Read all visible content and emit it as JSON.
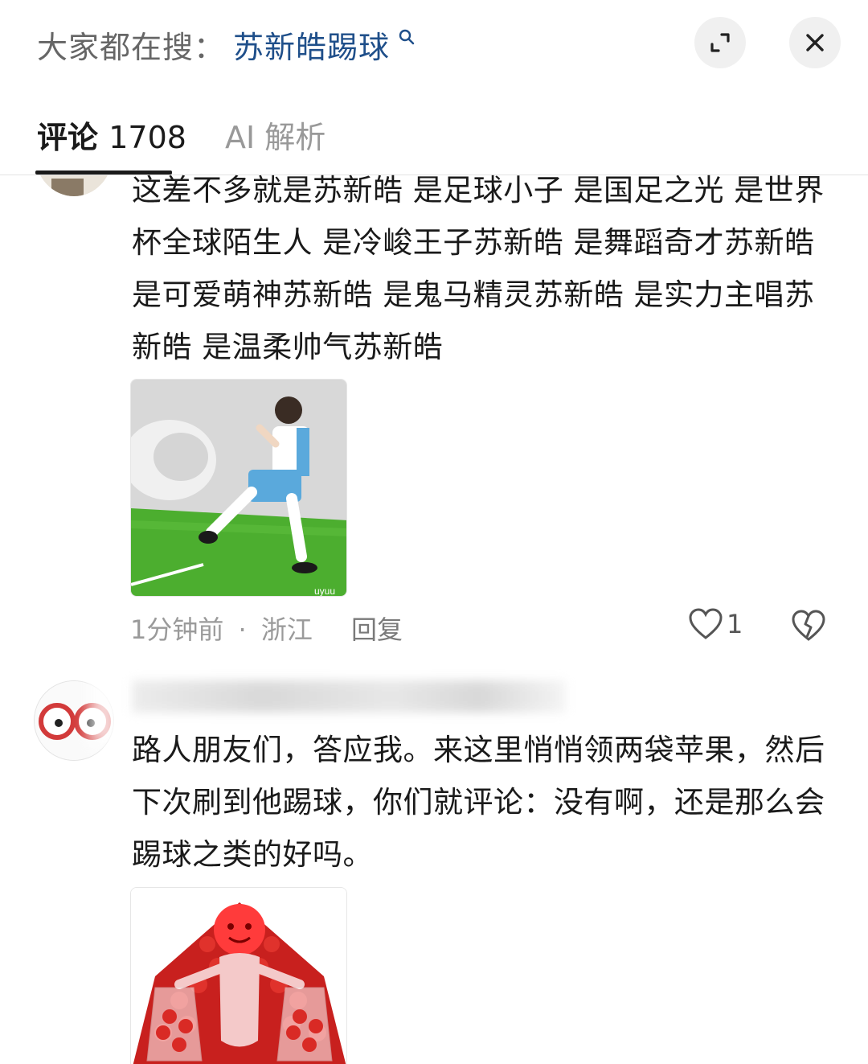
{
  "header": {
    "search_prefix": "大家都在搜：",
    "search_term": "苏新皓踢球",
    "icons": [
      "search-icon",
      "expand-icon",
      "close-icon"
    ]
  },
  "tabs": [
    {
      "label": "评论",
      "count": "1708",
      "active": true
    },
    {
      "label": "AI 解析",
      "active": false
    }
  ],
  "comments": [
    {
      "text": "这差不多就是苏新皓 是足球小子 是国足之光 是世界杯全球陌生人 是冷峻王子苏新皓 是舞蹈奇才苏新皓 是可爱萌神苏新皓 是鬼马精灵苏新皓 是实力主唱苏新皓 是温柔帅气苏新皓",
      "image_watermark": "uyuu",
      "time": "1分钟前",
      "location": "浙江",
      "meta_separator": "·",
      "reply_label": "回复",
      "likes": "1"
    },
    {
      "text": "路人朋友们，答应我。来这里悄悄领两袋苹果，然后下次刷到他踢球，你们就评论：没有啊，还是那么会踢球之类的好吗。"
    }
  ],
  "colors": {
    "link_blue": "#1f4f8a",
    "muted_gray": "#9a9a9a",
    "button_bg": "#f0f0f0"
  }
}
